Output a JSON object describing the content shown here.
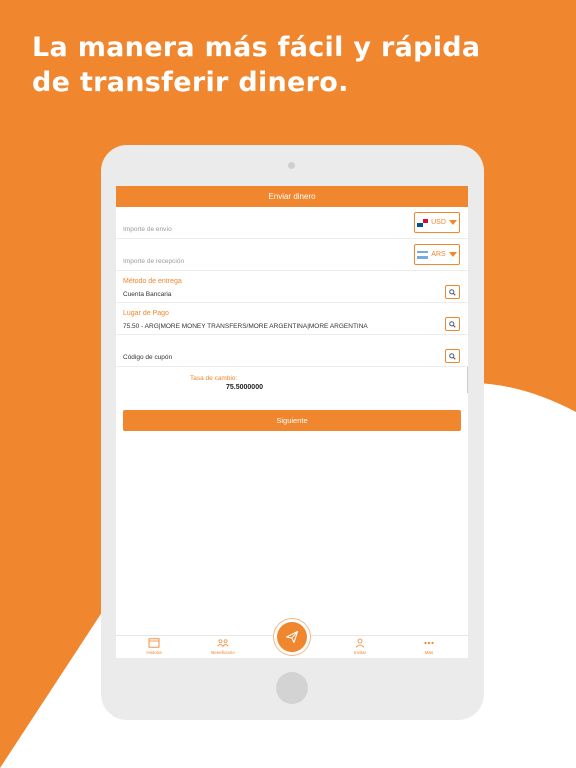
{
  "headline": {
    "line1": "La manera más fácil y rápida",
    "line2": "de transferir dinero."
  },
  "colors": {
    "brand": "#f0862e",
    "background": "#ffffff",
    "tablet": "#ebebeb"
  },
  "header": {
    "title": "Enviar dinero"
  },
  "send_amount": {
    "placeholder": "Importe de envío",
    "currency": "USD",
    "flag_icon": "panama-flag-icon"
  },
  "receive_amount": {
    "placeholder": "Importe de recepción",
    "currency": "ARS",
    "flag_icon": "argentina-flag-icon"
  },
  "delivery_method": {
    "label": "Método de entrega",
    "value": "Cuenta Bancaria"
  },
  "payment_location": {
    "label": "Lugar de Pago",
    "value": "75.50 - ARG|MORE MONEY TRANSFERS/MORE ARGENTINA|MORE ARGENTINA"
  },
  "coupon": {
    "placeholder": "Código de cupón"
  },
  "exchange": {
    "label": "Tasa de cambio:",
    "value": "75.5000000"
  },
  "actions": {
    "next_label": "Siguiente"
  },
  "bottom_nav": {
    "items": [
      {
        "label": "Historia",
        "icon": "history-icon"
      },
      {
        "label": "Beneficiario",
        "icon": "beneficiary-icon"
      },
      {
        "label": "Invitar",
        "icon": "invite-icon"
      },
      {
        "label": "Más",
        "icon": "more-icon"
      }
    ],
    "center_icon": "send-icon"
  }
}
